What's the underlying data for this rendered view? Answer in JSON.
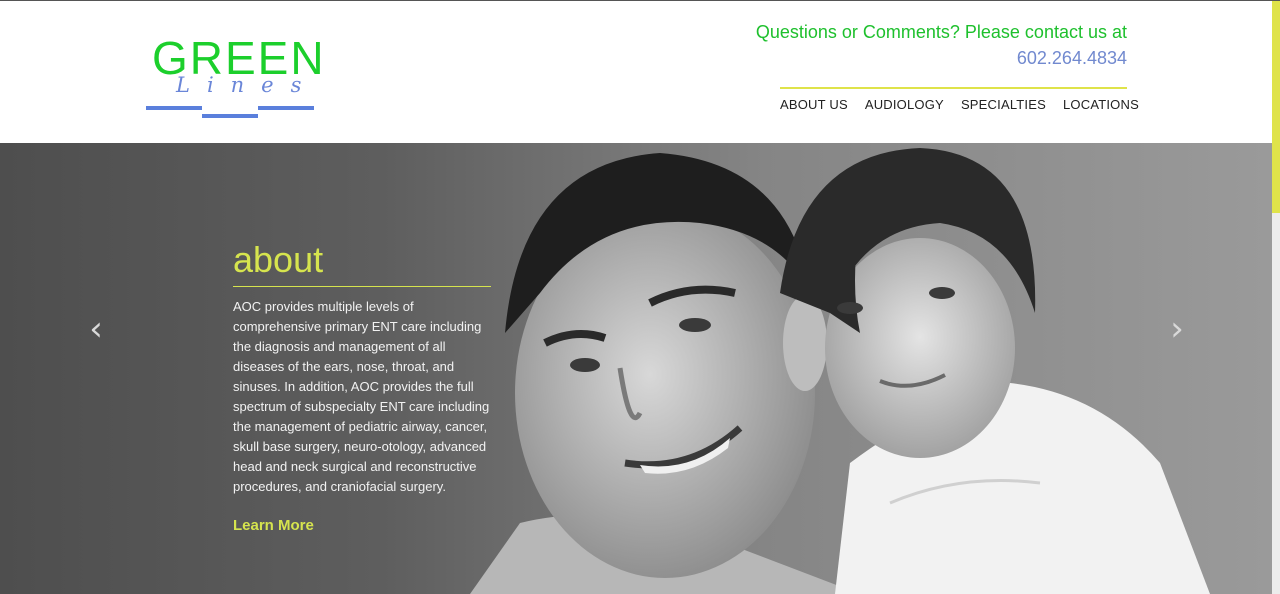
{
  "logo": {
    "word": "GREEN",
    "sub": "Lines"
  },
  "contact": {
    "question": "Questions or Comments? Please contact us at",
    "phone": "602.264.4834"
  },
  "nav": {
    "items": [
      "ABOUT US",
      "AUDIOLOGY",
      "SPECIALTIES",
      "LOCATIONS"
    ]
  },
  "hero": {
    "heading": "about",
    "body": "AOC provides multiple levels of comprehensive primary ENT care including the diagnosis and management of all diseases of the ears, nose, throat, and sinuses. In addition, AOC provides the full spectrum of subspecialty ENT care including the management of pediatric airway, cancer, skull base surgery, neuro-otology, advanced head and neck surgical and reconstructive procedures, and craniofacial surgery.",
    "cta": "Learn More",
    "prev_icon": "chevron-left-icon",
    "next_icon": "chevron-right-icon"
  },
  "colors": {
    "brand_green": "#1ccf2c",
    "accent_yellow": "#d6e44e",
    "link_blue": "#7189cf"
  }
}
